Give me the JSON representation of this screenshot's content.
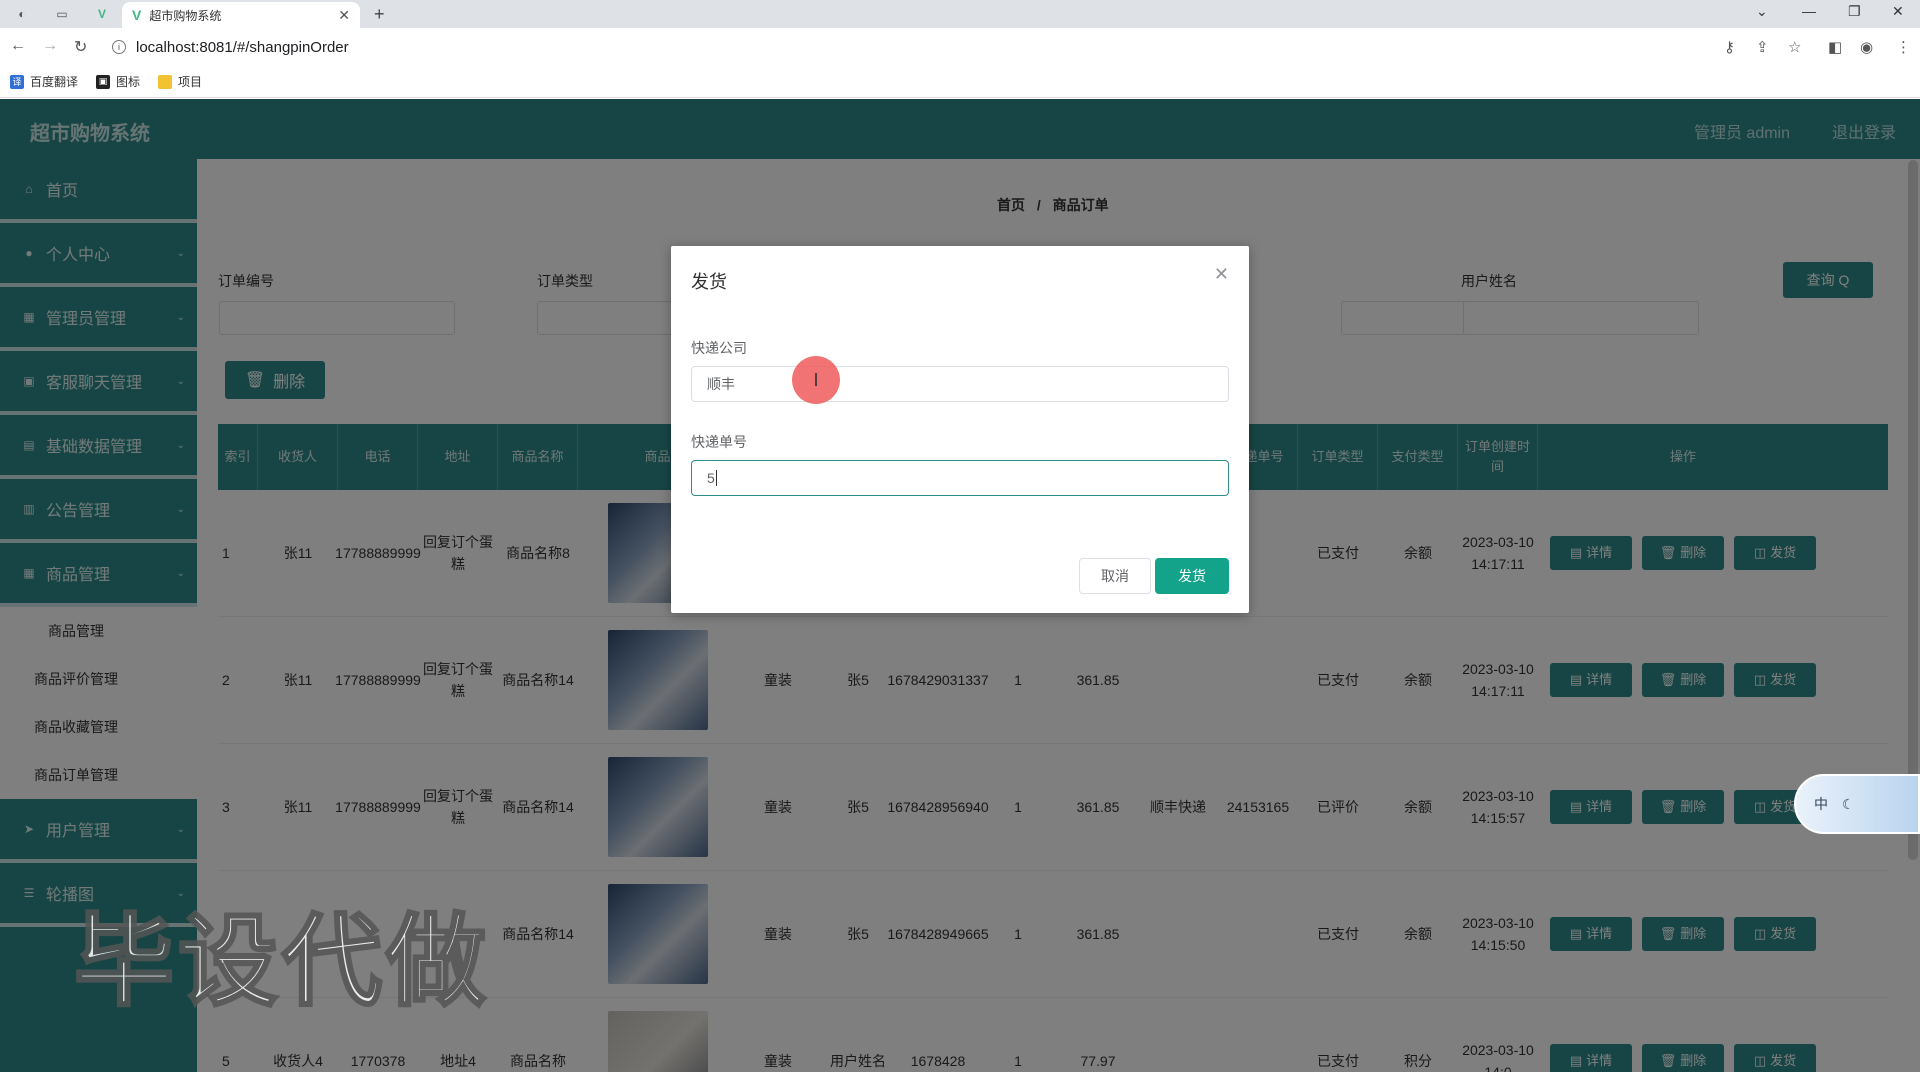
{
  "browser": {
    "tab_title": "超市购物系统",
    "url": "localhost:8081/#/shangpinOrder",
    "bookmarks": [
      "百度翻译",
      "图标",
      "项目"
    ]
  },
  "header": {
    "app_title": "超市购物系统",
    "user_label": "管理员 admin",
    "logout_label": "退出登录"
  },
  "sidebar": {
    "items": [
      {
        "label": "首页"
      },
      {
        "label": "个人中心"
      },
      {
        "label": "管理员管理"
      },
      {
        "label": "客服聊天管理"
      },
      {
        "label": "基础数据管理"
      },
      {
        "label": "公告管理"
      },
      {
        "label": "商品管理"
      },
      {
        "label": "用户管理"
      },
      {
        "label": "轮播图"
      }
    ],
    "submenu": [
      "商品管理",
      "商品评价管理",
      "商品收藏管理",
      "商品订单管理"
    ]
  },
  "breadcrumb": {
    "home": "首页",
    "sep": "/",
    "current": "商品订单"
  },
  "filters": {
    "order_no_label": "订单编号",
    "order_type_label": "订单类型",
    "user_name_label": "用户姓名",
    "query_label": "查询 Q"
  },
  "delete_button": "删除",
  "table": {
    "headers": [
      "索引",
      "收货人",
      "电话",
      "地址",
      "商品名称",
      "商品",
      "",
      "",
      "",
      "",
      "",
      "快递单号",
      "订单类型",
      "支付类型",
      "订单创建时间",
      "操作"
    ],
    "rows": [
      {
        "idx": "1",
        "receiver": "张11",
        "phone": "17788889999",
        "addr": "回复订个蛋糕",
        "product": "商品名称8",
        "cat": "",
        "user": "",
        "order_no": "",
        "qty": "",
        "price": "",
        "express": "",
        "express_no": "",
        "type": "已支付",
        "pay": "余额",
        "time": "2023-03-10 14:17:11"
      },
      {
        "idx": "2",
        "receiver": "张11",
        "phone": "17788889999",
        "addr": "回复订个蛋糕",
        "product": "商品名称14",
        "cat": "童装",
        "user": "张5",
        "order_no": "1678429031337",
        "qty": "1",
        "price": "361.85",
        "express": "",
        "express_no": "",
        "type": "已支付",
        "pay": "余额",
        "time": "2023-03-10 14:17:11"
      },
      {
        "idx": "3",
        "receiver": "张11",
        "phone": "17788889999",
        "addr": "回复订个蛋糕",
        "product": "商品名称14",
        "cat": "童装",
        "user": "张5",
        "order_no": "1678428956940",
        "qty": "1",
        "price": "361.85",
        "express": "顺丰快递",
        "express_no": "24153165",
        "type": "已评价",
        "pay": "余额",
        "time": "2023-03-10 14:15:57"
      },
      {
        "idx": "",
        "receiver": "",
        "phone": "",
        "addr": "",
        "product": "商品名称14",
        "cat": "童装",
        "user": "张5",
        "order_no": "1678428949665",
        "qty": "1",
        "price": "361.85",
        "express": "",
        "express_no": "",
        "type": "已支付",
        "pay": "余额",
        "time": "2023-03-10 14:15:50"
      },
      {
        "idx": "5",
        "receiver": "收货人4",
        "phone": "1770378",
        "addr": "地址4",
        "product": "商品名称",
        "cat": "童装",
        "user": "用户姓名",
        "order_no": "1678428",
        "qty": "1",
        "price": "77.97",
        "express": "",
        "express_no": "",
        "type": "已支付",
        "pay": "积分",
        "time": "2023-03-10 14:0"
      }
    ],
    "op_labels": {
      "detail": "详情",
      "delete": "删除",
      "ship": "发货"
    }
  },
  "dialog": {
    "title": "发货",
    "company_label": "快递公司",
    "company_value": "顺丰",
    "number_label": "快递单号",
    "number_value": "5",
    "cancel_label": "取消",
    "ok_label": "发货"
  },
  "ime": {
    "label": "中"
  },
  "watermark": "毕设代做",
  "colors": {
    "primary": "#2e8b8b",
    "ok": "#13a38a"
  }
}
